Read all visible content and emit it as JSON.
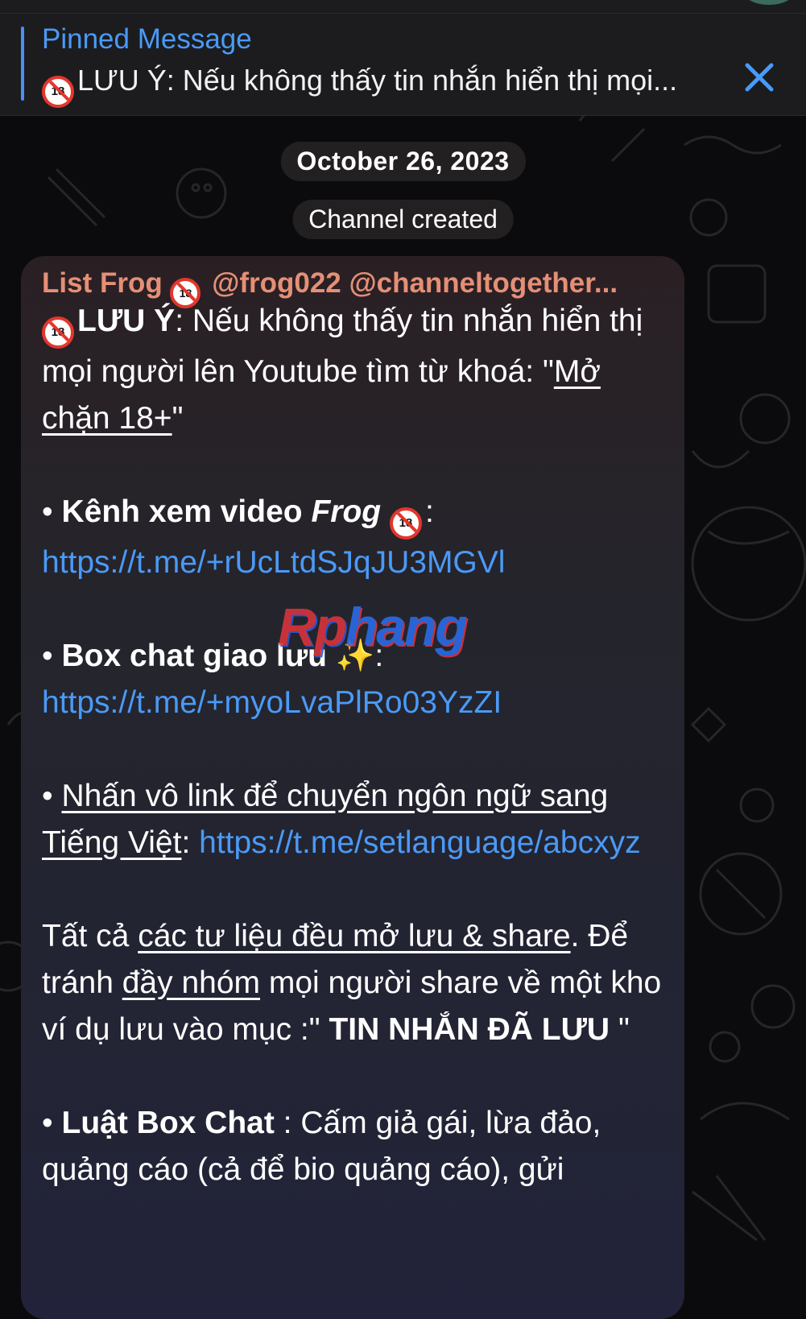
{
  "pinned": {
    "title": "Pinned Message",
    "text": "LƯU Ý: Nếu không thấy tin nhắn hiển thị mọi..."
  },
  "date_label": "October 26, 2023",
  "service_message": "Channel created",
  "message": {
    "sender": "List Frog",
    "sender_handles": "@frog022 @channeltogether...",
    "emoji_18_label": "18",
    "p1_bold": "LƯU Ý",
    "p1_text": ": Nếu không thấy tin nhắn hiển thị mọi người lên Youtube tìm từ khoá: \"",
    "p1_keyword": "Mở chặn 18+",
    "p1_end": "\"",
    "p2_bullet": "• ",
    "p2_label": "Kênh xem video ",
    "p2_label_italic": "Frog",
    "p2_colon": ": ",
    "p2_link": "https://t.me/+rUcLtdSJqJU3MGVl",
    "p3_bullet": "• ",
    "p3_label": "Box chat giao lưu ",
    "p3_sparkle": "✨",
    "p3_colon": ": ",
    "p3_link": "https://t.me/+myoLvaPlRo03YzZI",
    "p4_bullet": "• ",
    "p4_underlined": "Nhấn vô link để chuyển ngôn ngữ sang Tiếng Việt",
    "p4_colon": ": ",
    "p4_link": "https://t.me/setlanguage/abcxyz",
    "p5_a": "Tất cả ",
    "p5_u1": "các tư liệu đều mở lưu & share",
    "p5_b": ". Để tránh ",
    "p5_u2": "đầy nhóm",
    "p5_c": " mọi người share về một kho ví dụ lưu vào mục :\" ",
    "p5_bold": "TIN NHẮN ĐÃ LƯU",
    "p5_end": " \"",
    "p6_bullet": "• ",
    "p6_bold": "Luật Box Chat",
    "p6_text": " : Cấm giả gái, lừa đảo, quảng cáo (cả để bio quảng cáo), gửi"
  },
  "watermark": {
    "part1": "Rp",
    "part2": "hang"
  },
  "colors": {
    "link": "#4a9af7",
    "sender": "#e58f76",
    "pinned_accent": "#4a8ff5"
  }
}
